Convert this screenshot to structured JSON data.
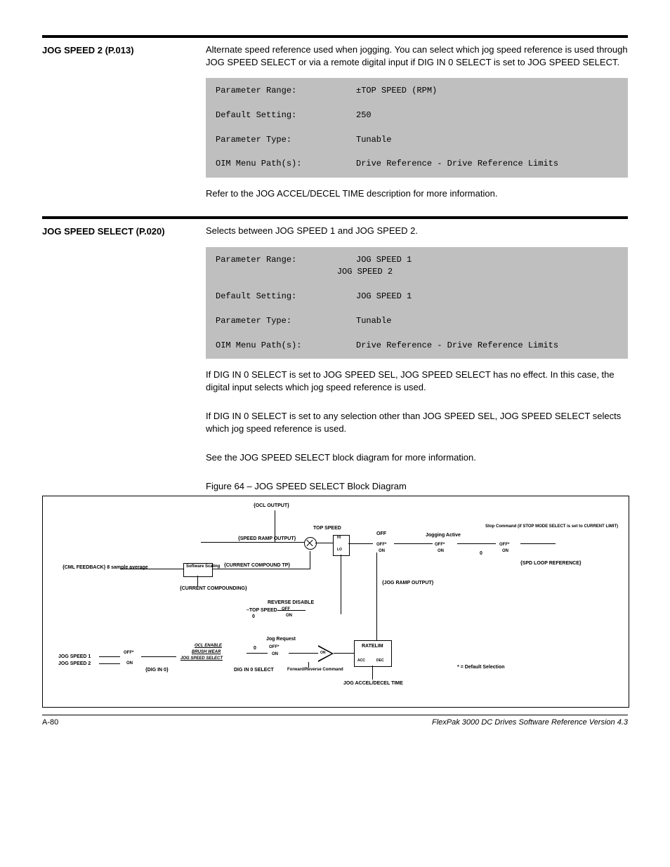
{
  "param1": {
    "label": "JOG SPEED 2 (P.013)",
    "desc": "Alternate speed reference used when jogging. You can select which jog speed reference is used through JOG SPEED SELECT or via a remote digital input if DIG IN 0 SELECT is set to JOG SPEED SELECT.",
    "spec": {
      "range_label": "Parameter Range:",
      "range_value": "±TOP SPEED (RPM)",
      "default_label": "Default Setting:",
      "default_value": "250",
      "type_label": "Parameter Type:",
      "type_value": "Tunable",
      "menu_label": "OIM Menu Path(s):",
      "menu_value": "Drive Reference - Drive Reference Limits"
    },
    "after": "Refer to the JOG ACCEL/DECEL TIME description for more information."
  },
  "param2": {
    "label": "JOG SPEED SELECT (P.020)",
    "desc": "Selects between JOG SPEED 1 and JOG SPEED 2.",
    "spec": {
      "range_label": "Parameter Range:",
      "range_value": "JOG SPEED 1\n                        JOG SPEED 2",
      "default_label": "Default Setting:",
      "default_value": "JOG SPEED 1",
      "type_label": "Parameter Type:",
      "type_value": "Tunable",
      "menu_label": "OIM Menu Path(s):",
      "menu_value": "Drive Reference - Drive Reference Limits"
    },
    "after1": "If DIG IN 0 SELECT is set to JOG SPEED SEL, JOG SPEED SELECT has no effect. In this case, the digital input selects which jog speed reference is used.",
    "after2": "If DIG IN 0 SELECT is set to any selection other than JOG SPEED SEL, JOG SPEED SELECT selects which jog speed reference is used.",
    "after3": "See the JOG SPEED SELECT block diagram for more information."
  },
  "figure_caption": "Figure 64 – JOG SPEED SELECT Block Diagram",
  "diagram": {
    "ocl_output": "{OCL OUTPUT}",
    "speed_ramp": "{SPEED RAMP OUTPUT}",
    "current_comp_tp": "{CURRENT COMPOUND TP}",
    "cml_fb": "{CML FEEDBACK}\n8 sample average",
    "soft_scale": "Software\nScaling",
    "cur_comp": "{CURRENT\nCOMPOUNDING}",
    "top_speed": "TOP SPEED",
    "neg_top": "–TOP SPEED",
    "rev_disable": "REVERSE DISABLE",
    "jog_ramp": "{JOG RAMP OUTPUT}",
    "jogging_active": "Jogging Active",
    "stop_cmd": "Stop Command\n(if STOP MODE SELECT is\nset to CURRENT LIMIT)",
    "spd_loop": "{SPD LOOP\nREFERENCE}",
    "jog_req": "Jog Request",
    "ratelim": "RATELIM",
    "jog_adt": "JOG ACCEL/DECEL TIME",
    "fr_cmd": "Forward/Reverse\nCommand",
    "dig_in0_sel": "DIG IN 0 SELECT",
    "dig_in0": "{DIG IN 0}",
    "ocl_enable": "OCL ENABLE",
    "brush_wear": "BRUSH WEAR",
    "jog_speed_sel": "JOG SPEED SELECT",
    "jog_speed1": "JOG SPEED 1",
    "jog_speed2": "JOG SPEED 2",
    "off": "OFF",
    "on": "ON",
    "hi": "HI",
    "lo": "LO",
    "acc": "ACC",
    "dec": "DEC",
    "default_sel": "= Default Selection",
    "star": "*",
    "zero": "0"
  },
  "footer": {
    "left": "A-80",
    "right": "FlexPak 3000 DC Drives Software Reference Version 4.3"
  }
}
